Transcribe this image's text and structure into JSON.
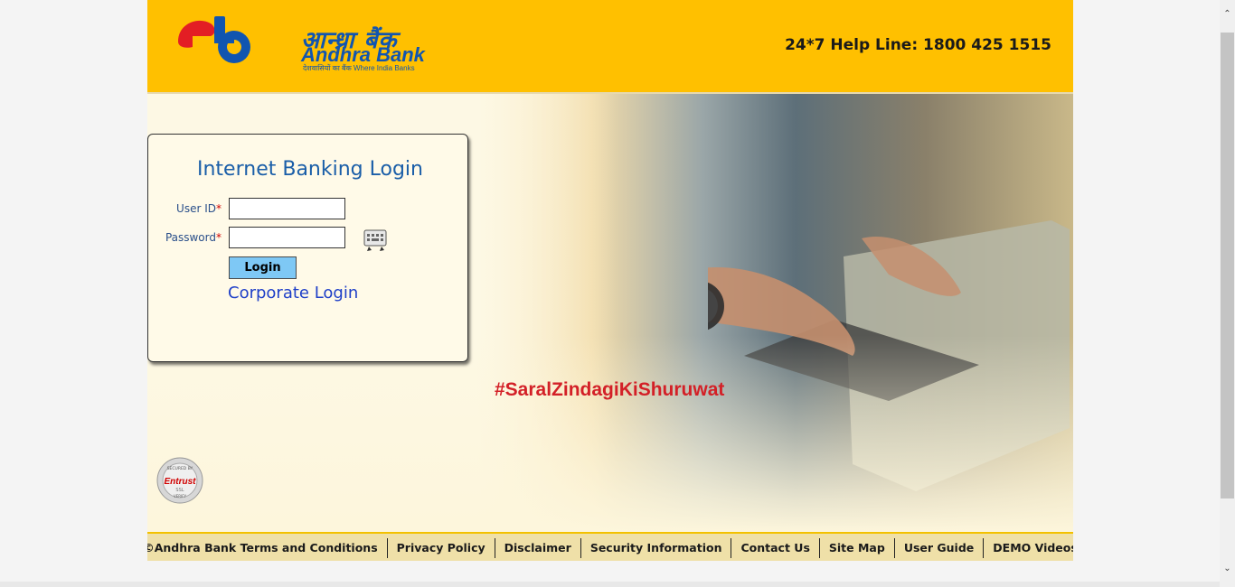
{
  "header": {
    "logo_hindi": "आन्ध्रा बैंक",
    "logo_name": "Andhra Bank",
    "logo_tagline": "देशवासियों का बैंक  Where India Banks",
    "helpline": "24*7 Help Line: 1800 425 1515"
  },
  "login": {
    "title": "Internet Banking Login",
    "user_id_label": "User ID",
    "password_label": "Password",
    "required_mark": "*",
    "user_id_value": "",
    "password_value": "",
    "login_button": "Login",
    "corporate_login": "Corporate Login"
  },
  "hero": {
    "hashtag": "#SaralZindagiKiShuruwat"
  },
  "badge": {
    "secured_by": "SECURED BY",
    "brand": "Entrust",
    "ssl": "SSL",
    "verify": "VERIFY"
  },
  "footer": {
    "links": [
      "©Andhra Bank Terms and Conditions",
      "Privacy Policy",
      "Disclaimer",
      "Security Information",
      "Contact Us",
      "Site Map",
      "User Guide",
      "DEMO Videos"
    ]
  },
  "colors": {
    "header_bg": "#ffc000",
    "brand_blue": "#1155b0",
    "brand_red": "#e31e24",
    "login_button_bg": "#7ec8f5",
    "hashtag_red": "#d32027",
    "footer_bg": "#efe0a8"
  }
}
